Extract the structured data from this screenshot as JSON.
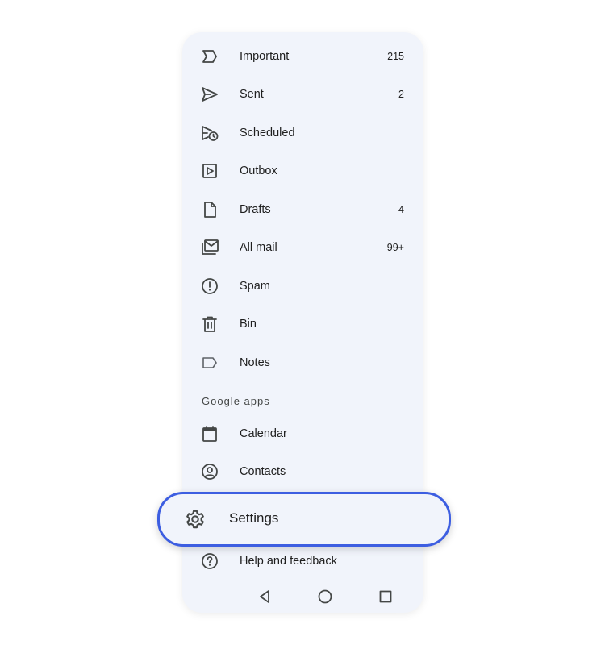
{
  "menu": {
    "items": [
      {
        "label": "Important",
        "count": "215",
        "icon": "important-icon"
      },
      {
        "label": "Sent",
        "count": "2",
        "icon": "send-icon"
      },
      {
        "label": "Scheduled",
        "count": "",
        "icon": "scheduled-icon"
      },
      {
        "label": "Outbox",
        "count": "",
        "icon": "outbox-icon"
      },
      {
        "label": "Drafts",
        "count": "4",
        "icon": "draft-icon"
      },
      {
        "label": "All mail",
        "count": "99+",
        "icon": "all-mail-icon"
      },
      {
        "label": "Spam",
        "count": "",
        "icon": "spam-icon"
      },
      {
        "label": "Bin",
        "count": "",
        "icon": "trash-icon"
      },
      {
        "label": "Notes",
        "count": "",
        "icon": "label-icon"
      }
    ]
  },
  "google_apps": {
    "heading": "Google apps",
    "items": [
      {
        "label": "Calendar",
        "icon": "calendar-icon"
      },
      {
        "label": "Contacts",
        "icon": "contacts-icon"
      }
    ]
  },
  "settings": {
    "label": "Settings",
    "icon": "gear-icon"
  },
  "help": {
    "label": "Help and feedback",
    "icon": "help-icon"
  },
  "nav": [
    "back-icon",
    "home-icon",
    "recents-icon"
  ],
  "colors": {
    "panel": "#f1f4fb",
    "highlight_border": "#3d5ee1",
    "text": "#1f1f1f",
    "icon": "#444746"
  }
}
